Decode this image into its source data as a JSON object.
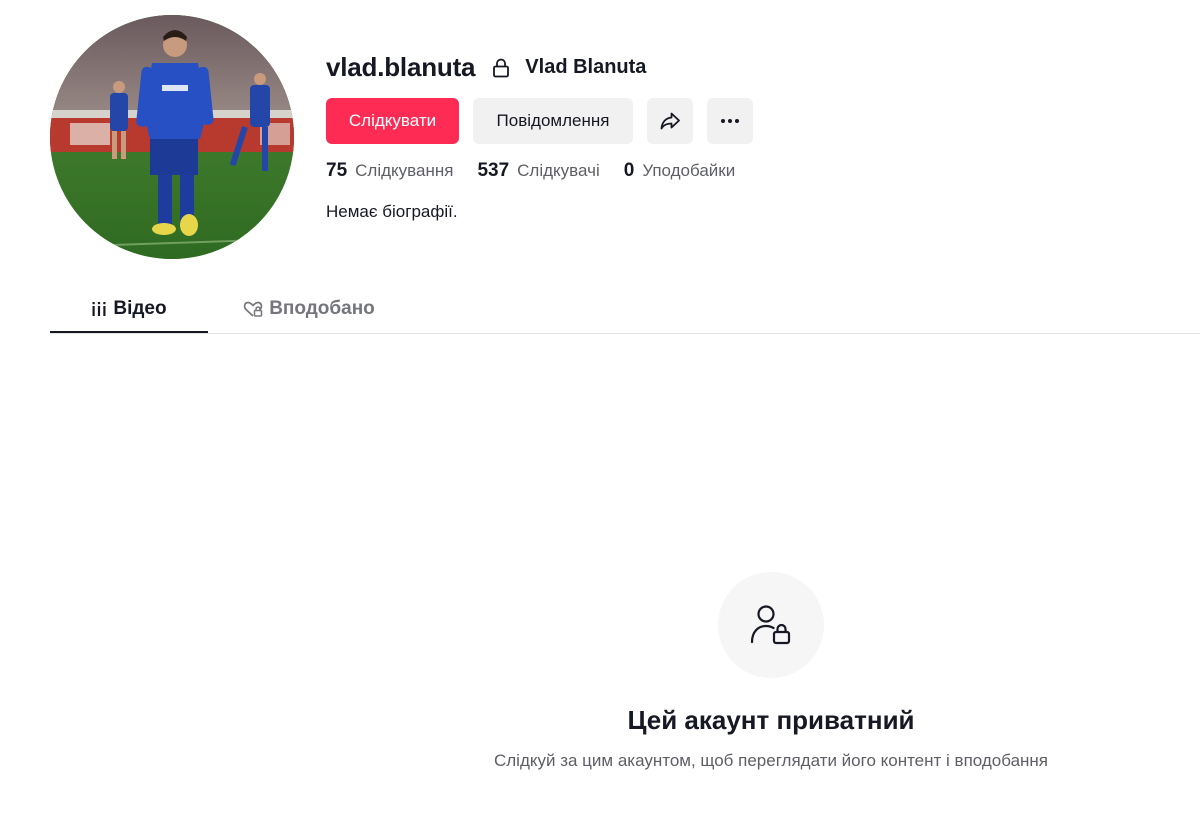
{
  "profile": {
    "username": "vlad.blanuta",
    "display_name": "Vlad Blanuta",
    "bio": "Немає біографії."
  },
  "actions": {
    "follow_label": "Слідкувати",
    "message_label": "Повідомлення",
    "share_icon": "share-icon",
    "more_icon": "more-icon"
  },
  "stats": {
    "following_count": "75",
    "following_label": "Слідкування",
    "followers_count": "537",
    "followers_label": "Слідкувачі",
    "likes_count": "0",
    "likes_label": "Уподобайки"
  },
  "tabs": {
    "videos_label": "Відео",
    "liked_label": "Вподобано",
    "active": "videos"
  },
  "private_notice": {
    "title": "Цей акаунт приватний",
    "subtitle": "Слідкуй за цим акаунтом, щоб переглядати його контент і вподобання"
  },
  "colors": {
    "accent": "#fe2c55",
    "text_primary": "#161823",
    "text_secondary": "#5e5f66",
    "button_bg": "#f1f1f2"
  }
}
